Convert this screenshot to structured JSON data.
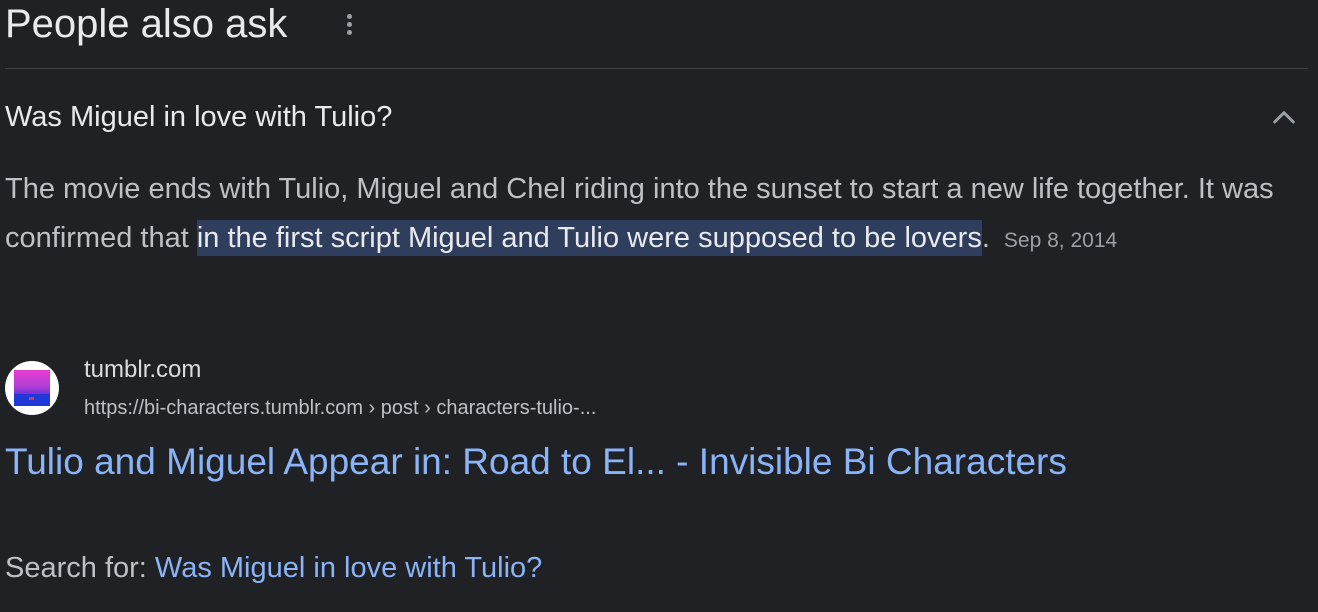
{
  "section": {
    "title": "People also ask",
    "menu_icon": "more-vert-icon"
  },
  "question": {
    "text": "Was Miguel in love with Tulio?",
    "expanded": true,
    "toggle_icon": "chevron-up-icon"
  },
  "answer": {
    "text_before": "The movie ends with Tulio, Miguel and Chel riding into the sunset to start a new life together. It was confirmed that ",
    "highlighted": "in the first script Miguel and Tulio were supposed to be lovers",
    "text_after": ".",
    "date": "Sep 8, 2014",
    "highlight_color": "#2f3e5c"
  },
  "source": {
    "favicon_icon": "tumblr-favicon-icon",
    "site_name": "tumblr.com",
    "url": "https://bi-characters.tumblr.com › post › characters-tulio-...",
    "link_title": "Tulio and Miguel Appear in: Road to El... - Invisible Bi Characters",
    "link_color": "#8ab4f8"
  },
  "search_for": {
    "label": "Search for: ",
    "query": "Was Miguel in love with Tulio?"
  },
  "colors": {
    "background": "#202124",
    "primary_text": "#e8eaed",
    "secondary_text": "#bdc1c6",
    "muted_text": "#9aa0a6",
    "divider": "#3c4043"
  }
}
